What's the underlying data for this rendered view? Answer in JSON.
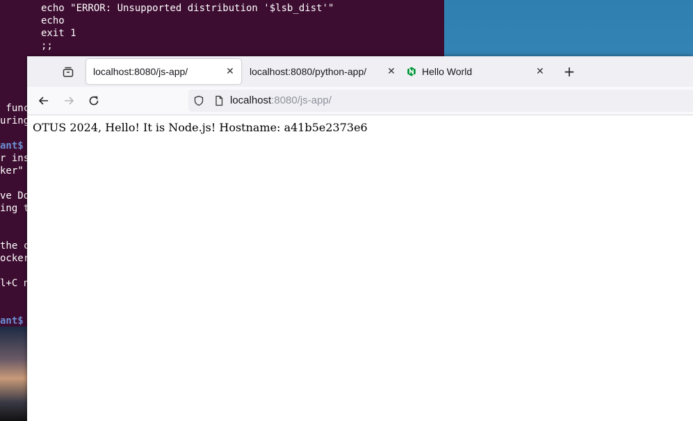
{
  "terminal": {
    "lines": [
      "echo \"ERROR: Unsupported distribution '$lsb_dist'\"",
      "echo",
      "exit 1",
      ";;"
    ],
    "left_fragments": [
      " func",
      "uring",
      "ant$",
      "r ins",
      "ker\"",
      "ve Do",
      "ing t",
      "the c",
      "ocker",
      "l+C n",
      "ant$"
    ]
  },
  "browser": {
    "tabs": [
      {
        "title": "localhost:8080/js-app/",
        "active": true
      },
      {
        "title": "localhost:8080/python-app/",
        "active": false
      },
      {
        "title": "Hello World",
        "active": false,
        "favicon": "nginx-icon"
      }
    ],
    "url_host": "localhost",
    "url_rest": ":8080/js-app/",
    "page_text": "OTUS 2024, Hello! It is Node.js! Hostname: a41b5e2373e6"
  },
  "colors": {
    "terminal_bg": "#3d0d31",
    "prompt_blue": "#6d8fd4",
    "nginx_green": "#009639"
  }
}
